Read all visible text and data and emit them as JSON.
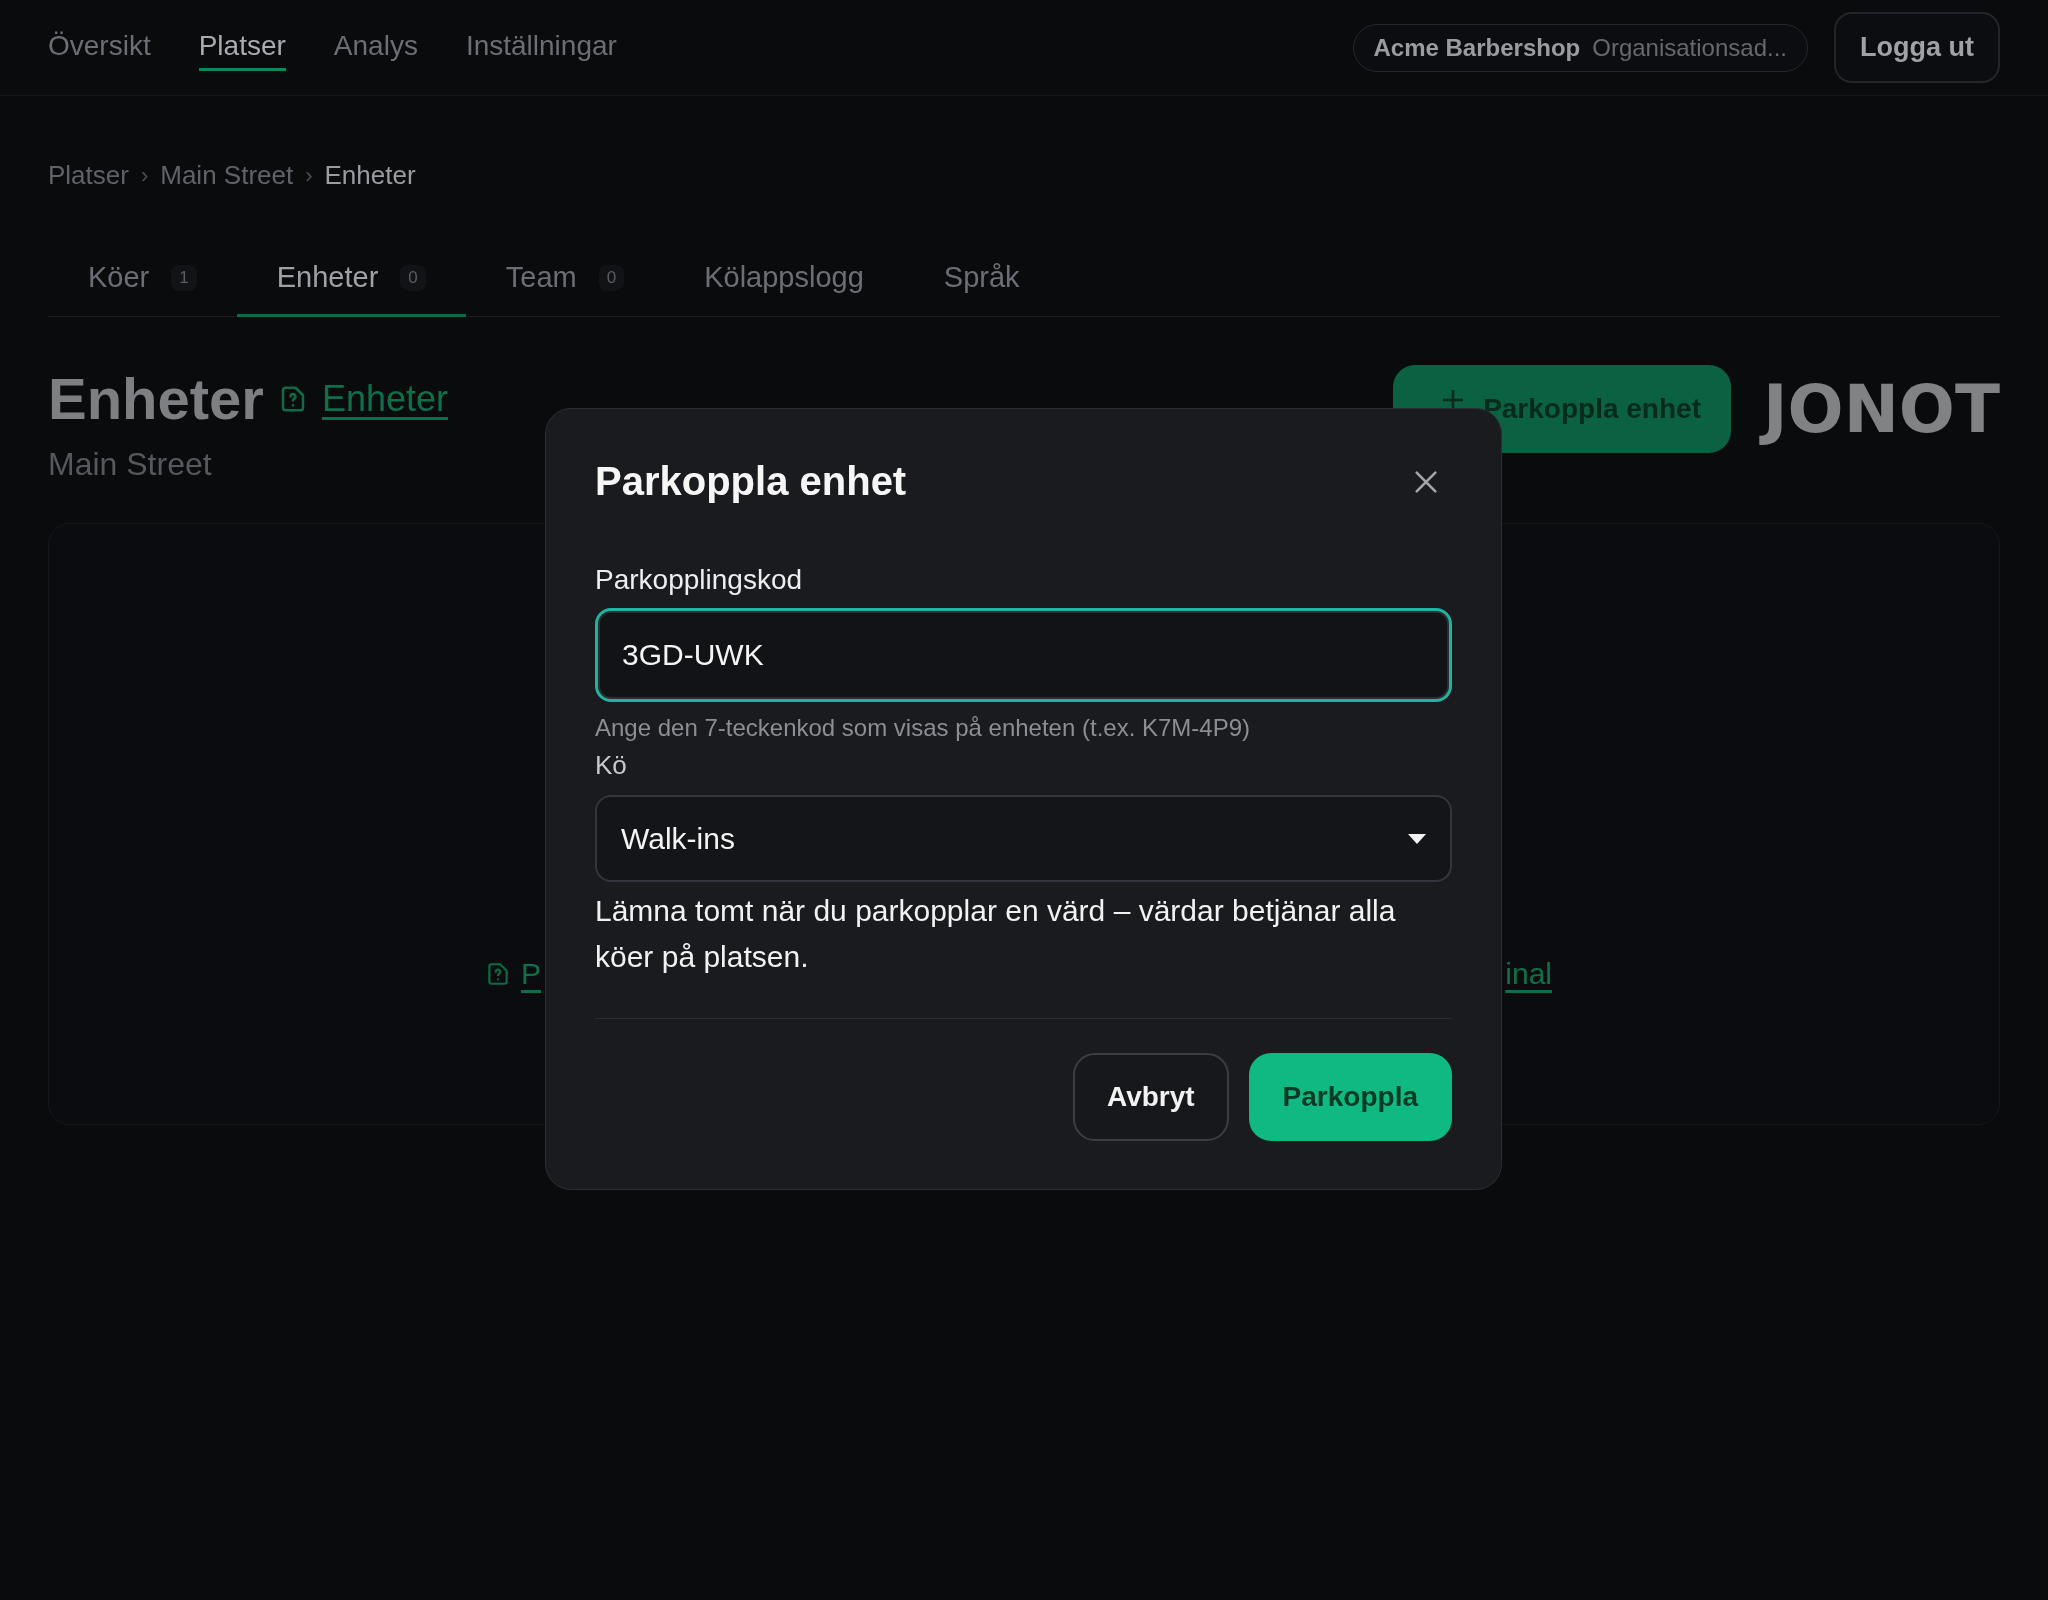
{
  "nav": {
    "items": [
      {
        "label": "Översikt",
        "selected": false
      },
      {
        "label": "Platser",
        "selected": true
      },
      {
        "label": "Analys",
        "selected": false
      },
      {
        "label": "Inställningar",
        "selected": false
      }
    ],
    "org": {
      "name": "Acme Barbershop",
      "detail": "Organisationsad..."
    },
    "logout": "Logga ut"
  },
  "breadcrumb": [
    {
      "kind": "link",
      "label": "Platser"
    },
    {
      "kind": "separator",
      "label": "›"
    },
    {
      "kind": "link",
      "label": "Main Street"
    },
    {
      "kind": "separator",
      "label": "›"
    },
    {
      "kind": "current",
      "label": "Enheter"
    }
  ],
  "tabs": [
    {
      "label": "Köer",
      "count": "1",
      "selected": false
    },
    {
      "label": "Enheter",
      "count": "0",
      "selected": true
    },
    {
      "label": "Team",
      "count": "0",
      "selected": false
    },
    {
      "label": "Kölappslogg",
      "selected": false
    },
    {
      "label": "Språk",
      "selected": false
    }
  ],
  "header": {
    "title": "Enheter",
    "help_link": "Enheter",
    "subtitle": "Main Street",
    "primary_button": "Parkoppla enhet",
    "logo": "JONOT"
  },
  "empty_state": {
    "left_link": "P",
    "right_link": "inal"
  },
  "dialog": {
    "title": "Parkoppla enhet",
    "code_field": {
      "label": "Parkopplingskod",
      "value": "3GD-UWK",
      "hint": "Ange den 7-teckenkod som visas på enheten (t.ex. K7M-4P9)"
    },
    "queue_field": {
      "label": "Kö",
      "value": "Walk-ins",
      "help": "Lämna tomt när du parkopplar en värd – värdar betjänar alla köer på platsen."
    },
    "buttons": [
      {
        "kind": "secondary",
        "label": "Avbryt"
      },
      {
        "kind": "primary",
        "label": "Parkoppla"
      }
    ]
  }
}
